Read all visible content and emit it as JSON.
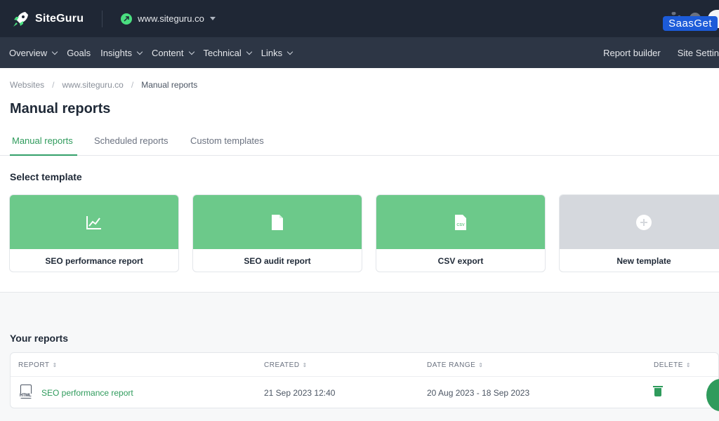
{
  "brand": {
    "name": "SiteGuru"
  },
  "site_switcher": {
    "domain": "www.siteguru.co"
  },
  "watermark": {
    "text": "SaasGet"
  },
  "nav": {
    "left": [
      {
        "label": "Overview",
        "dropdown": true
      },
      {
        "label": "Goals",
        "dropdown": false
      },
      {
        "label": "Insights",
        "dropdown": true
      },
      {
        "label": "Content",
        "dropdown": true
      },
      {
        "label": "Technical",
        "dropdown": true
      },
      {
        "label": "Links",
        "dropdown": true
      }
    ],
    "right": [
      {
        "label": "Report builder"
      },
      {
        "label": "Site Settin"
      }
    ]
  },
  "breadcrumb": [
    "Websites",
    "www.siteguru.co",
    "Manual reports"
  ],
  "breadcrumb_sep": "/",
  "page": {
    "title": "Manual reports"
  },
  "tabs": [
    "Manual reports",
    "Scheduled reports",
    "Custom templates"
  ],
  "templates": {
    "title": "Select template",
    "cards": [
      {
        "label": "SEO performance report",
        "icon": "line-chart-icon",
        "color": "#6cc98a"
      },
      {
        "label": "SEO audit report",
        "icon": "document-icon",
        "color": "#6cc98a"
      },
      {
        "label": "CSV export",
        "icon": "csv-file-icon",
        "icon_text": "CSV",
        "color": "#6cc98a"
      },
      {
        "label": "New template",
        "icon": "plus-circle-icon",
        "color": "#d5d8dd"
      }
    ]
  },
  "reports": {
    "title": "Your reports",
    "columns": [
      "REPORT",
      "CREATED",
      "DATE RANGE",
      "DELETE"
    ],
    "sort_glyph": "⇕",
    "rows": [
      {
        "file_type": "HTML",
        "report": "SEO performance report",
        "created": "21 Sep 2023 12:40",
        "date_range": "20 Aug 2023 - 18 Sep 2023"
      }
    ]
  },
  "colors": {
    "accent": "#2f9b5c",
    "card_green": "#6cc98a",
    "topbar": "#1f2735",
    "navbar": "#2d3645"
  }
}
